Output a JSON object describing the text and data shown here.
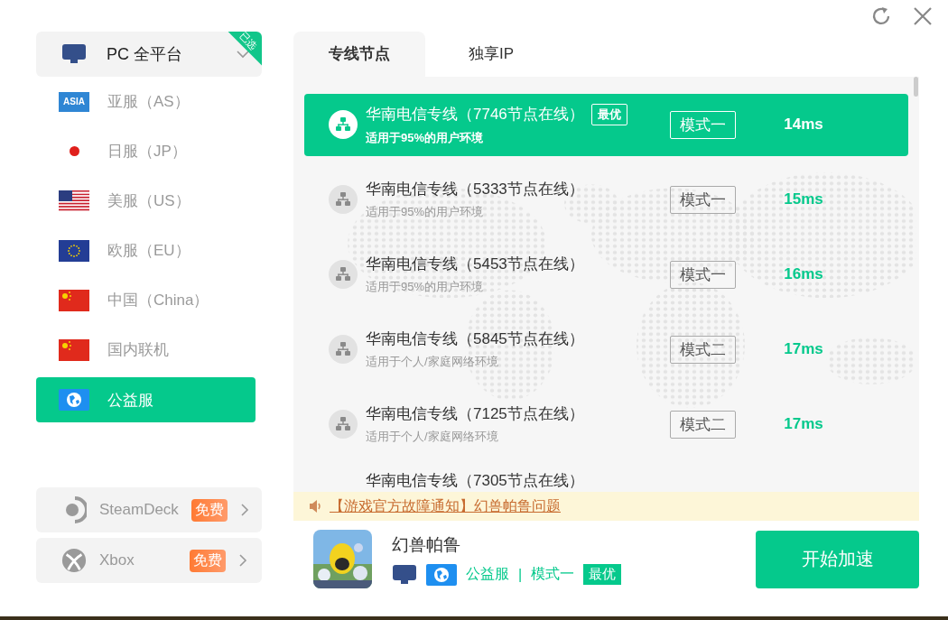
{
  "platform": {
    "label": "PC 全平台",
    "badge": "已选"
  },
  "regions": [
    {
      "label": "亚服（AS）",
      "kind": "asia",
      "flag_text": "ASIA",
      "selected": false
    },
    {
      "label": "日服（JP）",
      "kind": "jp",
      "selected": false
    },
    {
      "label": "美服（US）",
      "kind": "us",
      "selected": false
    },
    {
      "label": "欧服（EU）",
      "kind": "eu",
      "selected": false
    },
    {
      "label": "中国（China）",
      "kind": "cn",
      "selected": false
    },
    {
      "label": "国内联机",
      "kind": "cn",
      "selected": false
    },
    {
      "label": "公益服",
      "kind": "globe",
      "selected": true
    }
  ],
  "extras": [
    {
      "label": "SteamDeck",
      "badge": "免费",
      "kind": "steamdeck"
    },
    {
      "label": "Xbox",
      "badge": "免费",
      "kind": "xbox"
    }
  ],
  "tabs": [
    {
      "label": "专线节点",
      "selected": true
    },
    {
      "label": "独享IP",
      "selected": false
    }
  ],
  "nodes": [
    {
      "name": "华南电信专线（7746节点在线）",
      "desc": "适用于95%的用户环境",
      "tag": "最优",
      "mode": "模式一",
      "latency": "14ms",
      "selected": true
    },
    {
      "name": "华南电信专线（5333节点在线）",
      "desc": "适用于95%的用户环境",
      "mode": "模式一",
      "latency": "15ms",
      "selected": false
    },
    {
      "name": "华南电信专线（5453节点在线）",
      "desc": "适用于95%的用户环境",
      "mode": "模式一",
      "latency": "16ms",
      "selected": false
    },
    {
      "name": "华南电信专线（5845节点在线）",
      "desc": "适用于个人/家庭网络环境",
      "mode": "模式二",
      "latency": "17ms",
      "selected": false
    },
    {
      "name": "华南电信专线（7125节点在线）",
      "desc": "适用于个人/家庭网络环境",
      "mode": "模式二",
      "latency": "17ms",
      "selected": false
    },
    {
      "name": "华南电信专线（7305节点在线）",
      "selected": false
    }
  ],
  "notice": "【游戏官方故障通知】幻兽帕鲁问题",
  "game": {
    "title": "幻兽帕鲁",
    "server": "公益服",
    "separator": "|",
    "mode": "模式一",
    "tag": "最优"
  },
  "start_button": "开始加速"
}
